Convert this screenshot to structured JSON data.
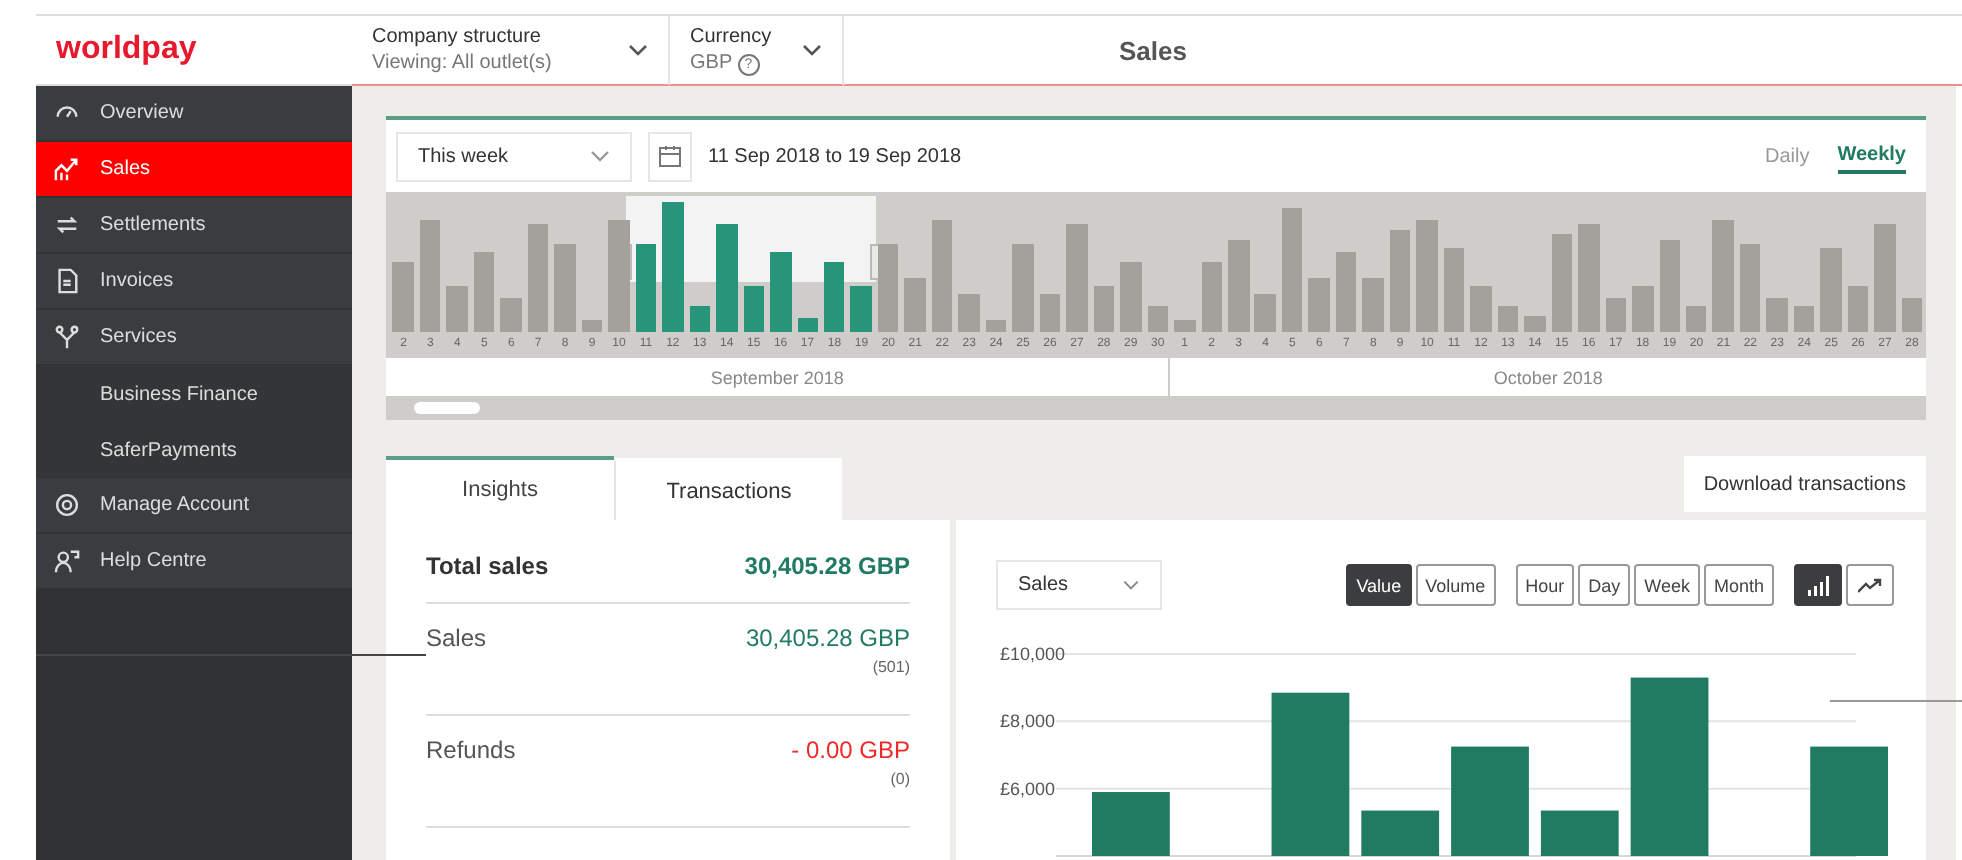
{
  "header": {
    "logo": "worldpay",
    "company": {
      "label": "Company structure",
      "value": "Viewing: All outlet(s)"
    },
    "currency": {
      "label": "Currency",
      "value": "GBP",
      "help": "?"
    },
    "title": "Sales"
  },
  "sidebar": {
    "items": [
      {
        "label": "Overview",
        "selected": false
      },
      {
        "label": "Sales",
        "selected": true
      },
      {
        "label": "Settlements",
        "selected": false
      },
      {
        "label": "Invoices",
        "selected": false
      },
      {
        "label": "Services",
        "selected": false,
        "children": [
          {
            "label": "Business Finance",
            "selected": false
          },
          {
            "label": "SaferPayments",
            "selected": false
          }
        ]
      },
      {
        "label": "Manage Account",
        "selected": false
      },
      {
        "label": "Help Centre",
        "selected": false
      }
    ]
  },
  "timeline": {
    "range_select": "This week",
    "date_range": "11 Sep 2018 to 19 Sep 2018",
    "granularity": [
      {
        "label": "Daily",
        "selected": false
      },
      {
        "label": "Weekly",
        "selected": true
      }
    ],
    "months": [
      {
        "label": "September 2018",
        "days": [
          {
            "label": "2",
            "selected": false
          },
          {
            "label": "3",
            "selected": false
          },
          {
            "label": "4",
            "selected": false
          },
          {
            "label": "5",
            "selected": false
          },
          {
            "label": "6",
            "selected": false
          },
          {
            "label": "7",
            "selected": false
          },
          {
            "label": "8",
            "selected": false
          },
          {
            "label": "9",
            "selected": false
          },
          {
            "label": "10",
            "selected": false
          },
          {
            "label": "11",
            "selected": true
          },
          {
            "label": "12",
            "selected": true
          },
          {
            "label": "13",
            "selected": true
          },
          {
            "label": "14",
            "selected": true
          },
          {
            "label": "15",
            "selected": true
          },
          {
            "label": "16",
            "selected": true
          },
          {
            "label": "17",
            "selected": true
          },
          {
            "label": "18",
            "selected": true
          },
          {
            "label": "19",
            "selected": true
          },
          {
            "label": "20",
            "selected": false
          },
          {
            "label": "21",
            "selected": false
          },
          {
            "label": "22",
            "selected": false
          },
          {
            "label": "23",
            "selected": false
          },
          {
            "label": "24",
            "selected": false
          },
          {
            "label": "25",
            "selected": false
          },
          {
            "label": "26",
            "selected": false
          },
          {
            "label": "27",
            "selected": false
          },
          {
            "label": "28",
            "selected": false
          },
          {
            "label": "29",
            "selected": false
          },
          {
            "label": "30",
            "selected": false
          }
        ]
      },
      {
        "label": "October 2018",
        "days": [
          {
            "label": "1",
            "selected": false
          },
          {
            "label": "2",
            "selected": false
          },
          {
            "label": "3",
            "selected": false
          },
          {
            "label": "4",
            "selected": false
          },
          {
            "label": "5",
            "selected": false
          },
          {
            "label": "6",
            "selected": false
          },
          {
            "label": "7",
            "selected": false
          },
          {
            "label": "8",
            "selected": false
          },
          {
            "label": "9",
            "selected": false
          },
          {
            "label": "10",
            "selected": false
          },
          {
            "label": "11",
            "selected": false
          },
          {
            "label": "12",
            "selected": false
          },
          {
            "label": "13",
            "selected": false
          },
          {
            "label": "14",
            "selected": false
          },
          {
            "label": "15",
            "selected": false
          },
          {
            "label": "16",
            "selected": false
          },
          {
            "label": "17",
            "selected": false
          },
          {
            "label": "18",
            "selected": false
          },
          {
            "label": "19",
            "selected": false
          },
          {
            "label": "20",
            "selected": false
          },
          {
            "label": "21",
            "selected": false
          },
          {
            "label": "22",
            "selected": false
          },
          {
            "label": "23",
            "selected": false
          },
          {
            "label": "24",
            "selected": false
          },
          {
            "label": "25",
            "selected": false
          },
          {
            "label": "26",
            "selected": false
          },
          {
            "label": "27",
            "selected": false
          },
          {
            "label": "28",
            "selected": false
          }
        ]
      }
    ]
  },
  "tabs": [
    {
      "label": "Insights",
      "selected": true
    },
    {
      "label": "Transactions",
      "selected": false
    }
  ],
  "download_button": "Download transactions",
  "insights": [
    {
      "kind": "total",
      "label": "Total sales",
      "value": "30,405.28 GBP"
    },
    {
      "kind": "positive",
      "label": "Sales",
      "value": "30,405.28 GBP",
      "count": "(501)"
    },
    {
      "kind": "negative",
      "label": "Refunds",
      "value": "- 0.00 GBP",
      "count": "(0)"
    }
  ],
  "chart_panel": {
    "metric_select": "Sales",
    "measure_buttons": [
      {
        "label": "Value",
        "selected": true
      },
      {
        "label": "Volume",
        "selected": false
      }
    ],
    "period_buttons": [
      {
        "label": "Hour",
        "selected": false
      },
      {
        "label": "Day",
        "selected": false
      },
      {
        "label": "Week",
        "selected": false
      },
      {
        "label": "Month",
        "selected": false
      }
    ],
    "chart_type_buttons": [
      {
        "kind": "bar",
        "selected": true
      },
      {
        "kind": "line",
        "selected": false
      }
    ],
    "chart_data": {
      "type": "bar",
      "values": [
        5900,
        null,
        8850,
        5350,
        7250,
        5350,
        9300,
        null,
        7250
      ],
      "ylim": [
        4000,
        10000
      ],
      "grid": true,
      "yticks": [
        {
          "value": 6000,
          "label": "£6,000"
        },
        {
          "value": 8000,
          "label": "£8,000"
        },
        {
          "value": 10000,
          "label": "£10,000"
        }
      ]
    }
  }
}
